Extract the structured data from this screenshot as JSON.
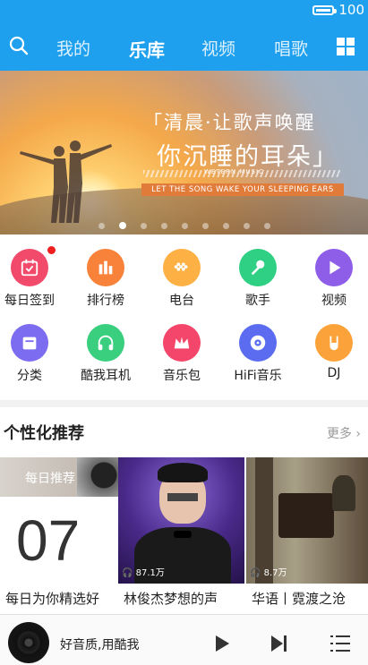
{
  "status_bar": {
    "battery_text": "100"
  },
  "nav": {
    "tabs": [
      {
        "label": "我的"
      },
      {
        "label": "乐库"
      },
      {
        "label": "视频"
      },
      {
        "label": "唱歌"
      }
    ],
    "active": "乐库"
  },
  "banner": {
    "line1": "「清晨·让歌声唤醒",
    "line2": "你沉睡的耳朵」",
    "small_text": "WETERN MUSIC",
    "tag": "LET THE SONG WAKE YOUR SLEEPING EARS",
    "page_count": 9,
    "active_page": 2
  },
  "categories": [
    {
      "label": "每日签到",
      "icon": "calendar-check-icon",
      "color": "#f14a6a",
      "badge": true
    },
    {
      "label": "排行榜",
      "icon": "bar-chart-icon",
      "color": "#f9823b"
    },
    {
      "label": "电台",
      "icon": "radio-icon",
      "color": "#fdb044"
    },
    {
      "label": "歌手",
      "icon": "microphone-icon",
      "color": "#2fcf84"
    },
    {
      "label": "视频",
      "icon": "play-icon",
      "color": "#8e5ee8"
    },
    {
      "label": "分类",
      "icon": "category-box-icon",
      "color": "#7c6cf0"
    },
    {
      "label": "酷我耳机",
      "icon": "headphones-icon",
      "color": "#39cf7f"
    },
    {
      "label": "音乐包",
      "icon": "crown-icon",
      "color": "#f4466a"
    },
    {
      "label": "HiFi音乐",
      "icon": "hifi-disc-icon",
      "color": "#5b6cf0"
    },
    {
      "label": "DJ",
      "icon": "rock-hand-icon",
      "color": "#fba33a"
    }
  ],
  "recommend": {
    "title": "个性化推荐",
    "more": "更多",
    "cards": [
      {
        "badge": "每日推荐",
        "day": "07",
        "caption": "每日为你精选好"
      },
      {
        "plays": "87.1万",
        "caption": "林俊杰梦想的声"
      },
      {
        "plays": "8.7万",
        "caption": "华语丨霓渡之沧"
      }
    ]
  },
  "player": {
    "title": "好音质,用酷我"
  },
  "colors": {
    "primary": "#1ea0ee"
  }
}
